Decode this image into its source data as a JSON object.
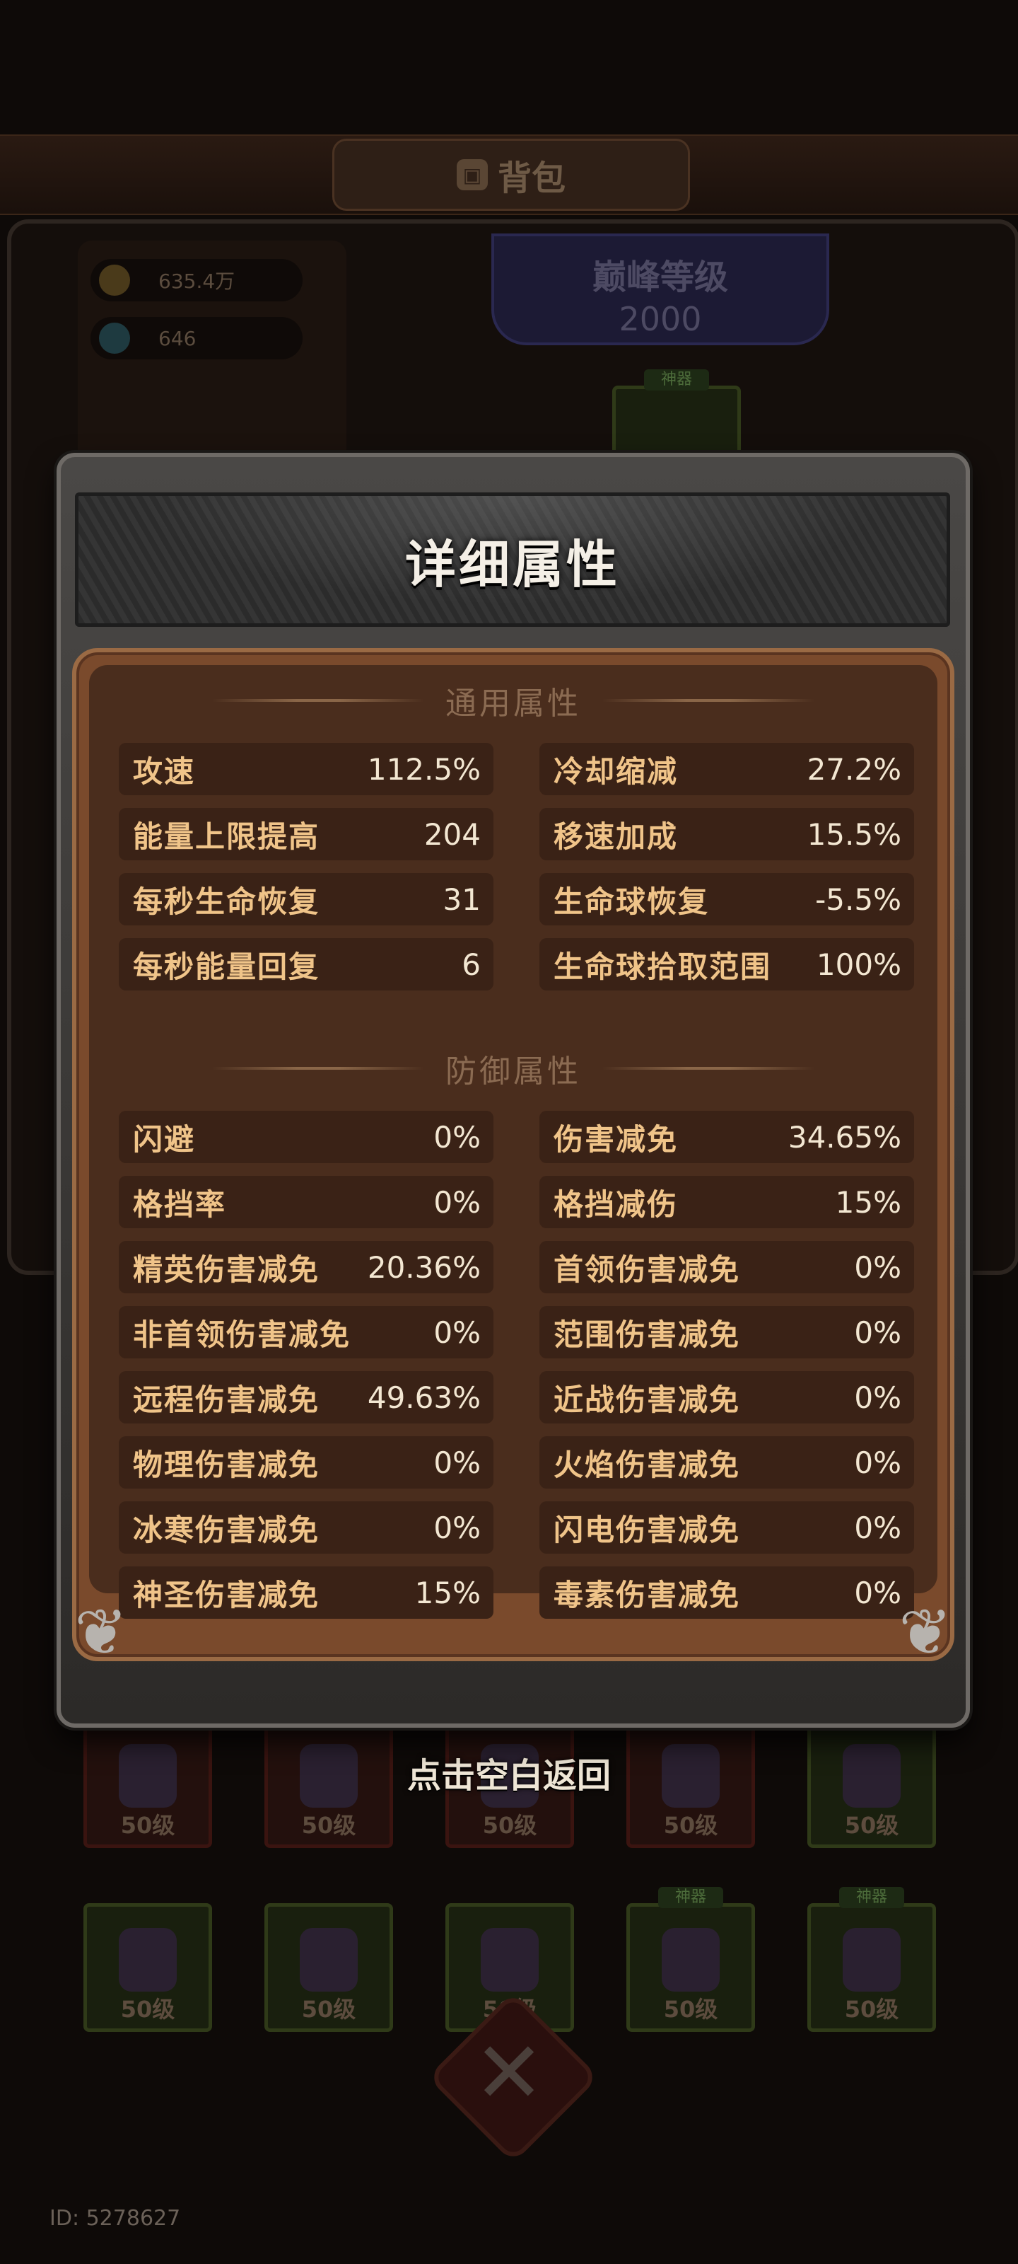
{
  "app": {
    "title": "背包",
    "id_label": "ID: 5278627",
    "back_hint": "点击空白返回"
  },
  "background": {
    "coins": "635.4万",
    "gems": "646",
    "peak_title": "巅峰等级",
    "peak_level": "2000",
    "god_badge": "神器",
    "slot_level": "50级"
  },
  "modal": {
    "title": "详细属性",
    "sections": [
      {
        "label": "通用属性",
        "stats": [
          {
            "name": "攻速",
            "value": "112.5%"
          },
          {
            "name": "冷却缩减",
            "value": "27.2%"
          },
          {
            "name": "能量上限提高",
            "value": "204"
          },
          {
            "name": "移速加成",
            "value": "15.5%"
          },
          {
            "name": "每秒生命恢复",
            "value": "31"
          },
          {
            "name": "生命球恢复",
            "value": "-5.5%"
          },
          {
            "name": "每秒能量回复",
            "value": "6"
          },
          {
            "name": "生命球拾取范围",
            "value": "100%"
          }
        ]
      },
      {
        "label": "防御属性",
        "stats": [
          {
            "name": "闪避",
            "value": "0%"
          },
          {
            "name": "伤害减免",
            "value": "34.65%"
          },
          {
            "name": "格挡率",
            "value": "0%"
          },
          {
            "name": "格挡减伤",
            "value": "15%"
          },
          {
            "name": "精英伤害减免",
            "value": "20.36%"
          },
          {
            "name": "首领伤害减免",
            "value": "0%"
          },
          {
            "name": "非首领伤害减免",
            "value": "0%"
          },
          {
            "name": "范围伤害减免",
            "value": "0%"
          },
          {
            "name": "远程伤害减免",
            "value": "49.63%"
          },
          {
            "name": "近战伤害减免",
            "value": "0%"
          },
          {
            "name": "物理伤害减免",
            "value": "0%"
          },
          {
            "name": "火焰伤害减免",
            "value": "0%"
          },
          {
            "name": "冰寒伤害减免",
            "value": "0%"
          },
          {
            "name": "闪电伤害减免",
            "value": "0%"
          },
          {
            "name": "神圣伤害减免",
            "value": "15%"
          },
          {
            "name": "毒素伤害减免",
            "value": "0%"
          }
        ]
      }
    ]
  }
}
